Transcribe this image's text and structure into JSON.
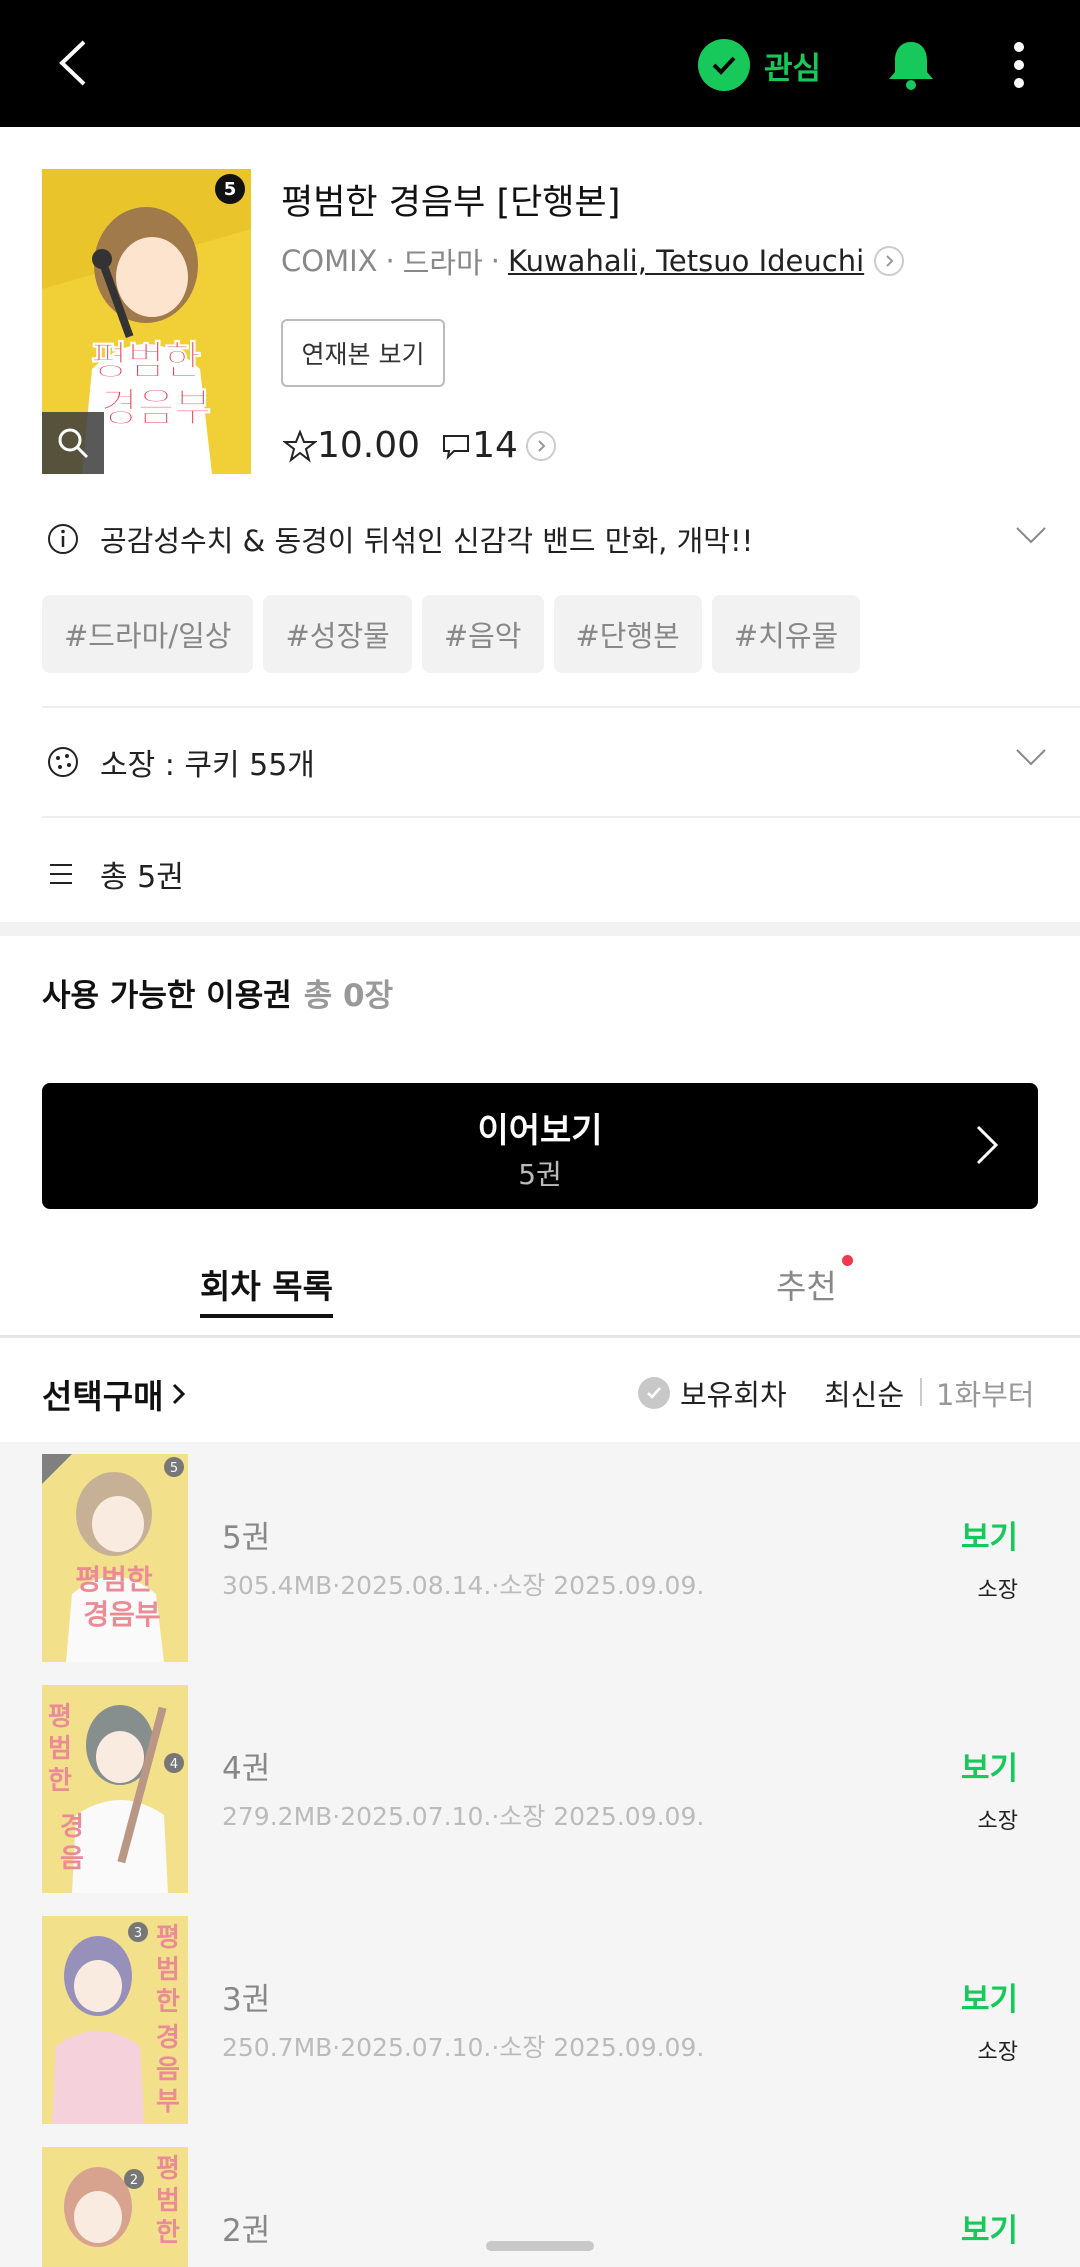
{
  "topbar": {
    "follow_label": "관심"
  },
  "comic": {
    "title": "평범한 경음부 [단행본]",
    "publisher": "COMIX",
    "sep1": "·",
    "genre": "드라마",
    "sep2": "·",
    "author": "Kuwahali, Tetsuo Ideuchi",
    "series_button": "연재본 보기",
    "rating": "10.00",
    "comments": "14",
    "cover_volume": "5",
    "cover_title_1": "평범한",
    "cover_title_2": "경음부"
  },
  "description": "공감성수치 & 동경이 뒤섞인 신감각 밴드 만화, 개막!!",
  "tags": [
    "#드라마/일상",
    "#성장물",
    "#음악",
    "#단행본",
    "#치유물"
  ],
  "ownership": "소장 : 쿠키 55개",
  "total_volumes": "총 5권",
  "passes": {
    "label": "사용 가능한 이용권",
    "count": "총 0장"
  },
  "continue": {
    "label": "이어보기",
    "sub": "5권"
  },
  "tabs": {
    "list": "회차 목록",
    "recommend": "추천"
  },
  "listbar": {
    "buy_select": "선택구매",
    "owned_filter": "보유회차",
    "sort_newest": "최신순",
    "sort_first": "1화부터"
  },
  "episodes": [
    {
      "volume": "5권",
      "info": "305.4MB·2025.08.14.·소장 2025.09.09.",
      "view": "보기",
      "owned": "소장",
      "num": "5"
    },
    {
      "volume": "4권",
      "info": "279.2MB·2025.07.10.·소장 2025.09.09.",
      "view": "보기",
      "owned": "소장",
      "num": "4"
    },
    {
      "volume": "3권",
      "info": "250.7MB·2025.07.10.·소장 2025.09.09.",
      "view": "보기",
      "owned": "소장",
      "num": "3"
    },
    {
      "volume": "2권",
      "info": "",
      "view": "보기",
      "owned": "",
      "num": "2"
    }
  ],
  "colors": {
    "accent_green": "#16c95a",
    "notify_dot": "#f0394b"
  }
}
